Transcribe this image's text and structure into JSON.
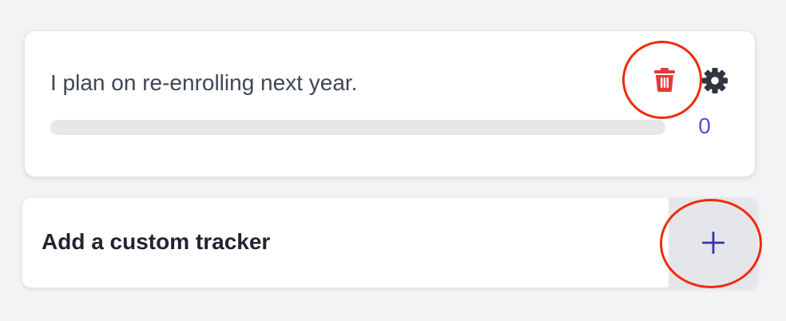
{
  "tracker": {
    "text": "I plan on re-enrolling next year.",
    "progress_percent": 0,
    "count": "0",
    "delete_icon": "trash-icon",
    "settings_icon": "gear-icon"
  },
  "add_tracker": {
    "label": "Add a custom tracker",
    "icon": "plus-icon"
  },
  "colors": {
    "accent": "#4f46e5",
    "count_text": "#5b47d6",
    "delete_red": "#e5383b",
    "annotation_red": "#f02a0a",
    "gear": "#2f3640"
  }
}
